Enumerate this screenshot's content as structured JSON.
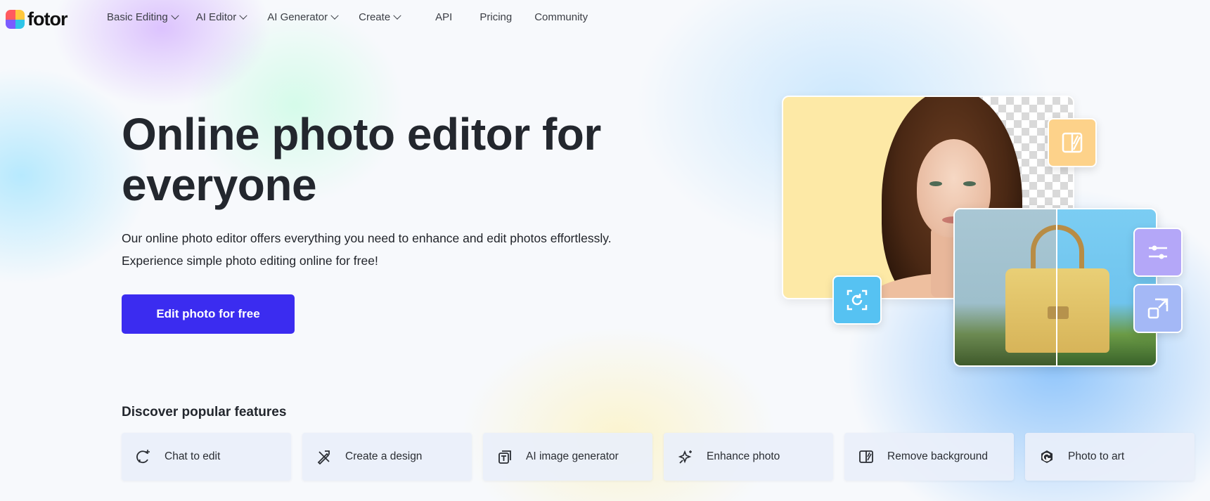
{
  "brand": {
    "name": "fotor"
  },
  "nav": {
    "items": [
      {
        "label": "Basic Editing",
        "dropdown": true
      },
      {
        "label": "AI Editor",
        "dropdown": true
      },
      {
        "label": "AI Generator",
        "dropdown": true
      },
      {
        "label": "Create",
        "dropdown": true
      },
      {
        "label": "API",
        "dropdown": false
      },
      {
        "label": "Pricing",
        "dropdown": false
      },
      {
        "label": "Community",
        "dropdown": false
      }
    ]
  },
  "hero": {
    "title_line1": "Online photo editor for",
    "title_line2": "everyone",
    "subtitle_line1": "Our online photo editor offers everything you need to enhance and edit photos effortlessly.",
    "subtitle_line2": "Experience simple photo editing online for free!",
    "cta_label": "Edit photo for free"
  },
  "features": {
    "title": "Discover popular features",
    "items": [
      {
        "label": "Chat to edit",
        "icon": "chat-sparkle-icon"
      },
      {
        "label": "Create a design",
        "icon": "design-pen-icon"
      },
      {
        "label": "AI image generator",
        "icon": "ai-image-icon"
      },
      {
        "label": "Enhance photo",
        "icon": "enhance-sparkle-icon"
      },
      {
        "label": "Remove background",
        "icon": "remove-bg-icon"
      },
      {
        "label": "Photo to art",
        "icon": "photo-art-icon"
      }
    ]
  },
  "colors": {
    "cta": "#3b2cf0",
    "tile_bg": "#fdd28a",
    "tile_rotate": "#56c2f2",
    "tile_adjust": "#b4a7f8",
    "tile_upscale": "#a4b8f6"
  }
}
